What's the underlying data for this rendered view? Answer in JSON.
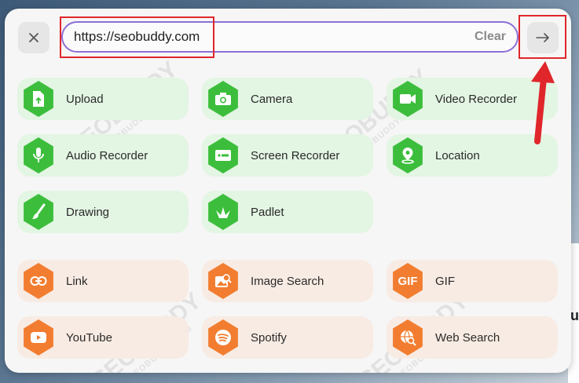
{
  "url_bar": {
    "value": "https://seobuddy.com",
    "clear_label": "Clear"
  },
  "icons": {
    "close": "close-icon",
    "go": "arrow-right-icon"
  },
  "groups": {
    "capture": [
      {
        "label": "Upload",
        "icon": "upload-file-icon"
      },
      {
        "label": "Camera",
        "icon": "camera-icon"
      },
      {
        "label": "Video Recorder",
        "icon": "video-camera-icon"
      },
      {
        "label": "Audio Recorder",
        "icon": "microphone-icon"
      },
      {
        "label": "Screen Recorder",
        "icon": "screen-record-icon"
      },
      {
        "label": "Location",
        "icon": "location-pin-icon"
      },
      {
        "label": "Drawing",
        "icon": "paintbrush-icon"
      },
      {
        "label": "Padlet",
        "icon": "padlet-bird-icon"
      }
    ],
    "links": [
      {
        "label": "Link",
        "icon": "link-icon"
      },
      {
        "label": "Image Search",
        "icon": "image-search-icon"
      },
      {
        "label": "GIF",
        "icon": "gif-icon",
        "badge": "GIF"
      },
      {
        "label": "YouTube",
        "icon": "youtube-icon"
      },
      {
        "label": "Spotify",
        "icon": "spotify-icon"
      },
      {
        "label": "Web Search",
        "icon": "web-search-icon"
      }
    ]
  },
  "watermark": {
    "brand": "SEOBUDDY",
    "site": "WWW.SEOBUDDY.COM"
  },
  "background_text": "u",
  "colors": {
    "green_accent": "#3cbe3c",
    "green_tile": "#e3f5e3",
    "orange_accent": "#f27d30",
    "orange_tile": "#f8ebe3",
    "url_border": "#8e6fd6",
    "highlight": "#e0262b"
  }
}
